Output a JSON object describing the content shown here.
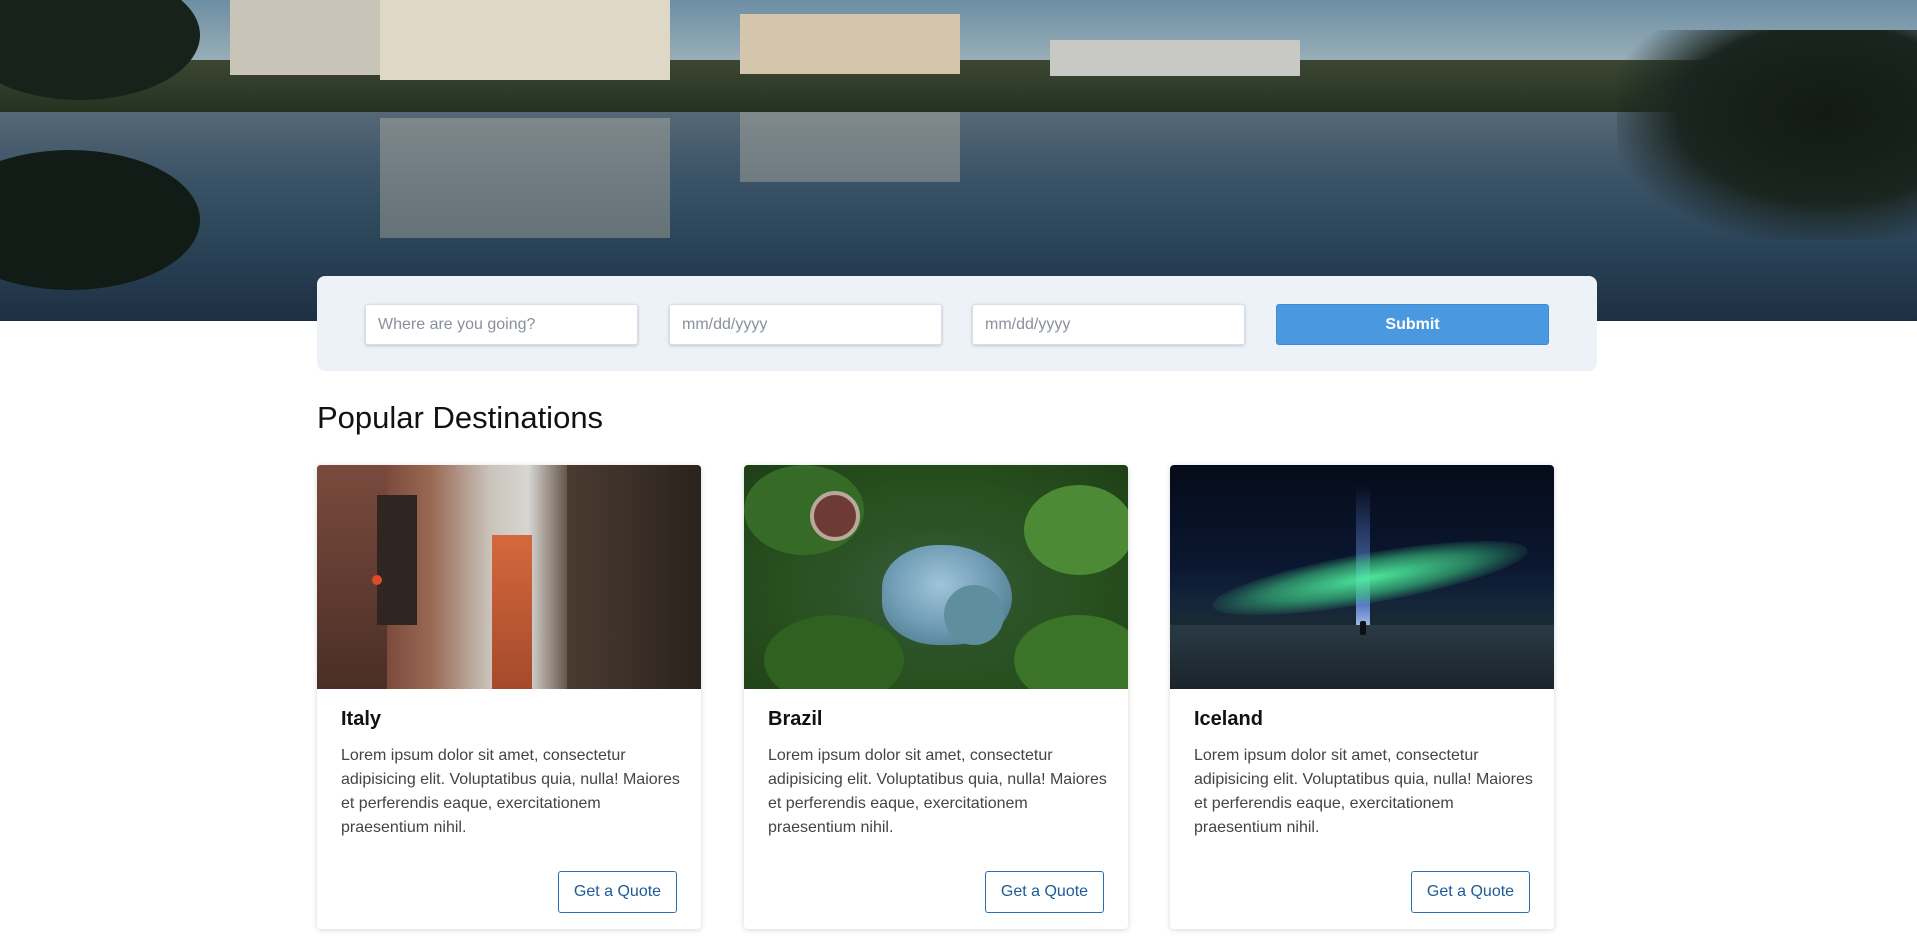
{
  "hero": {
    "image": "waterfront-houses-reflection"
  },
  "search": {
    "destination_placeholder": "Where are you going?",
    "checkin_placeholder": "mm/dd/yyyy",
    "checkout_placeholder": "mm/dd/yyyy",
    "submit_label": "Submit"
  },
  "destinations": {
    "title": "Popular Destinations",
    "cards": [
      {
        "name": "Italy",
        "description": "Lorem ipsum dolor sit amet, consectetur adipisicing elit. Voluptatibus quia, nulla! Maiores et perferendis eaque, exercitationem praesentium nihil.",
        "button": "Get a Quote",
        "image": "italy-narrow-street"
      },
      {
        "name": "Brazil",
        "description": "Lorem ipsum dolor sit amet, consectetur adipisicing elit. Voluptatibus quia, nulla! Maiores et perferendis eaque, exercitationem praesentium nihil.",
        "button": "Get a Quote",
        "image": "brazil-aerial-forest-lake"
      },
      {
        "name": "Iceland",
        "description": "Lorem ipsum dolor sit amet, consectetur adipisicing elit. Voluptatibus quia, nulla! Maiores et perferendis eaque, exercitationem praesentium nihil.",
        "button": "Get a Quote",
        "image": "iceland-northern-lights"
      }
    ]
  },
  "colors": {
    "primary": "#4a98e0",
    "panel_bg": "#edf1f8",
    "link": "#1e5a99"
  }
}
